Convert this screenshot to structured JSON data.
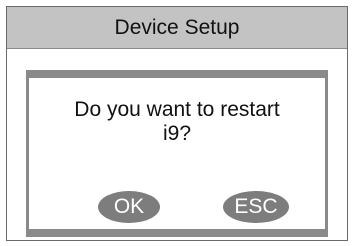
{
  "window": {
    "title": "Device Setup"
  },
  "dialog": {
    "message_line1": "Do you want to restart",
    "message_line2": "i9?",
    "ok_label": "OK",
    "esc_label": "ESC"
  },
  "colors": {
    "title_bar": "#c3c3c3",
    "frame": "#8a8a8a",
    "button": "#7d7d7d",
    "button_text": "#ffffff"
  }
}
